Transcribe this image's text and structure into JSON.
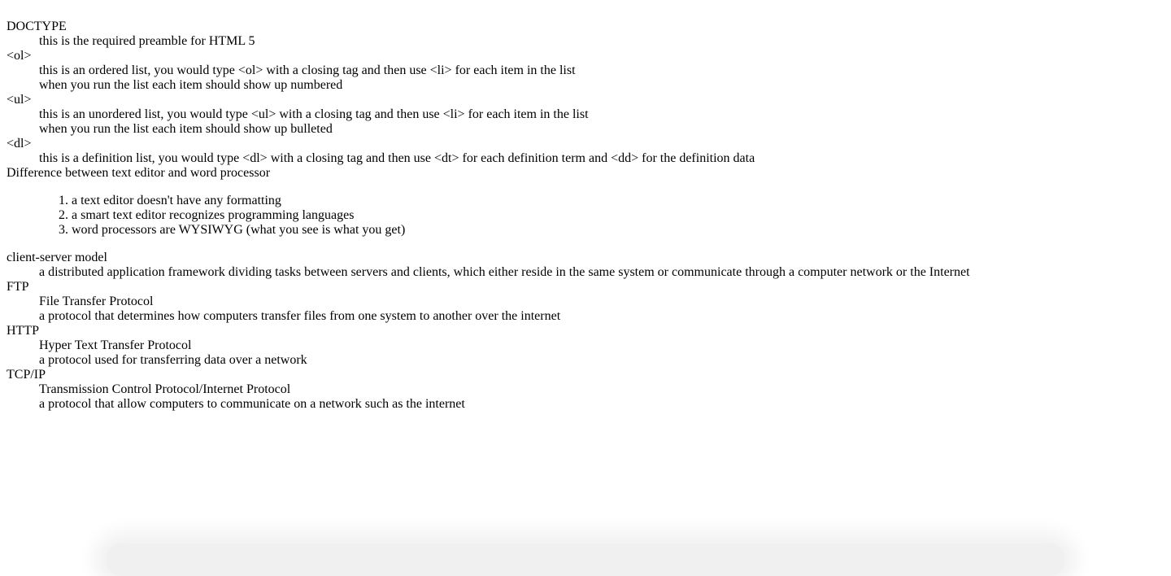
{
  "definitions": [
    {
      "term": "DOCTYPE",
      "descriptions": [
        "this is the required preamble for HTML 5"
      ]
    },
    {
      "term": "<ol>",
      "descriptions": [
        "this is an ordered list, you would type <ol> with a closing tag and then use <li> for each item in the list",
        "when you run the list each item should show up numbered"
      ]
    },
    {
      "term": "<ul>",
      "descriptions": [
        "this is an unordered list, you would type <ul> with a closing tag and then use <li> for each item in the list",
        "when you run the list each item should show up bulleted"
      ]
    },
    {
      "term": "<dl>",
      "descriptions": [
        "this is a definition list, you would type <dl> with a closing tag and then use <dt> for each definition term and <dd> for the definition data"
      ]
    }
  ],
  "difference": {
    "term": "Difference between text editor and word processor",
    "items": [
      "a text editor doesn't have any formatting",
      "a smart text editor recognizes programming languages",
      "word processors are WYSIWYG (what you see is what you get)"
    ]
  },
  "definitions2": [
    {
      "term": "client-server model",
      "descriptions": [
        "a distributed application framework dividing tasks between servers and clients, which either reside in the same system or communicate through a computer network or the Internet"
      ]
    },
    {
      "term": "FTP",
      "descriptions": [
        "File Transfer Protocol",
        "a protocol that determines how computers transfer files from one system to another over the internet"
      ]
    },
    {
      "term": "HTTP",
      "descriptions": [
        "Hyper Text Transfer Protocol",
        "a protocol used for transferring data over a network"
      ]
    },
    {
      "term": "TCP/IP",
      "descriptions": [
        "Transmission Control Protocol/Internet Protocol",
        "a protocol that allow computers to communicate on a network such as the internet"
      ]
    }
  ]
}
